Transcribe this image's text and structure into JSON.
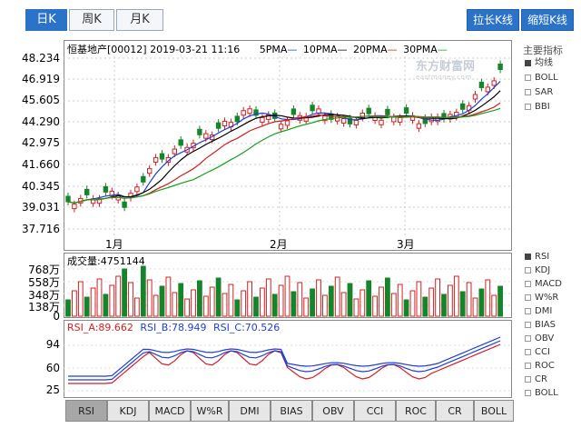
{
  "period_tabs": [
    {
      "label": "日K",
      "active": true
    },
    {
      "label": "周K",
      "active": false
    },
    {
      "label": "月K",
      "active": false
    }
  ],
  "toolbar": {
    "lengthen_label": "拉长K线",
    "shorten_label": "缩短K线"
  },
  "header": {
    "title": "恒基地产[00012] 2019-03-21 11:16",
    "ma": [
      {
        "label": "5PMA",
        "color": "#1f3fd6"
      },
      {
        "label": "10PMA",
        "color": "#000000"
      },
      {
        "label": "20PMA",
        "color": "#d42020"
      },
      {
        "label": "30PMA",
        "color": "#18a018"
      }
    ]
  },
  "watermark": {
    "brand": "东方财富网",
    "sub": "eastmoney.com"
  },
  "price_axis": [
    "48.234",
    "46.919",
    "45.605",
    "44.290",
    "42.975",
    "41.660",
    "40.345",
    "39.031",
    "37.716"
  ],
  "month_labels": [
    "1月",
    "2月",
    "3月"
  ],
  "volume": {
    "label": "成交量:4751144",
    "axis": [
      "768万",
      "558万",
      "348万",
      "138万",
      "0"
    ]
  },
  "rsi": {
    "labels": [
      {
        "text": "RSI_A:89.662",
        "color": "#d42020"
      },
      {
        "text": "RSI_B:78.949",
        "color": "#1f3fd6"
      },
      {
        "text": "RSI_C:70.526",
        "color": "#1f3fd6"
      }
    ],
    "axis": [
      "94",
      "60",
      "25"
    ]
  },
  "main_indicators": {
    "title": "主要指标",
    "items": [
      {
        "label": "均线",
        "checked": true
      },
      {
        "label": "BOLL",
        "checked": false
      },
      {
        "label": "SAR",
        "checked": false
      },
      {
        "label": "BBI",
        "checked": false
      }
    ]
  },
  "sub_indicators": [
    {
      "label": "RSI",
      "checked": true
    },
    {
      "label": "KDJ",
      "checked": false
    },
    {
      "label": "MACD",
      "checked": false
    },
    {
      "label": "W%R",
      "checked": false
    },
    {
      "label": "DMI",
      "checked": false
    },
    {
      "label": "BIAS",
      "checked": false
    },
    {
      "label": "OBV",
      "checked": false
    },
    {
      "label": "CCI",
      "checked": false
    },
    {
      "label": "ROC",
      "checked": false
    },
    {
      "label": "CR",
      "checked": false
    },
    {
      "label": "BOLL",
      "checked": false
    }
  ],
  "bottom_tabs": [
    {
      "label": "RSI",
      "active": true
    },
    {
      "label": "KDJ",
      "active": false
    },
    {
      "label": "MACD",
      "active": false
    },
    {
      "label": "W%R",
      "active": false
    },
    {
      "label": "DMI",
      "active": false
    },
    {
      "label": "BIAS",
      "active": false
    },
    {
      "label": "OBV",
      "active": false
    },
    {
      "label": "CCI",
      "active": false
    },
    {
      "label": "ROC",
      "active": false
    },
    {
      "label": "CR",
      "active": false
    },
    {
      "label": "BOLL",
      "active": false
    }
  ]
}
